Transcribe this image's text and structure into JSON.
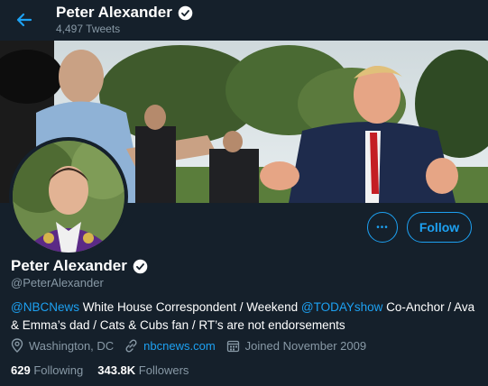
{
  "header": {
    "name": "Peter Alexander",
    "tweet_count": "4,497 Tweets"
  },
  "banner": {
    "description_icon": "photo-banner"
  },
  "actions": {
    "more_label": "•••",
    "follow_label": "Follow"
  },
  "profile": {
    "name": "Peter Alexander",
    "handle": "@PeterAlexander",
    "bio": {
      "mention1": "@NBCNews",
      "text1": " White House Correspondent / Weekend ",
      "mention2": "@TODAYshow",
      "text2": " Co-Anchor / Ava & Emma’s dad / Cats & Cubs fan / RT’s are not endorsements"
    },
    "location": "Washington, DC",
    "website": "nbcnews.com",
    "joined": "Joined November 2009",
    "following_count": "629",
    "following_label": "Following",
    "followers_count": "343.8K",
    "followers_label": "Followers"
  },
  "colors": {
    "background": "#15202b",
    "accent": "#1da1f2",
    "muted": "#8899a6"
  }
}
